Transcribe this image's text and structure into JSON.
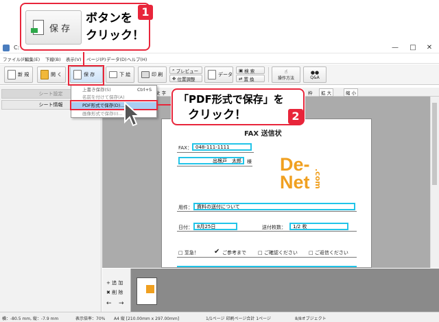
{
  "window": {
    "title": "C:\\Us...                                                    )ゼ２",
    "min": "—",
    "max": "□",
    "close": "✕"
  },
  "menu": [
    "ファイル(F)",
    "編集(E)",
    "下線(B)",
    "表示(V)",
    "ページ(P)",
    "データ(D)",
    "ヘルプ(H)"
  ],
  "toolbar": {
    "new_label": "新 規",
    "open_label": "開 く",
    "save_label": "保 存",
    "print_down_label": "下 絵",
    "print_label": "印 刷",
    "preview_label": "プレビュー",
    "position_label": "位置調整",
    "data_label": "データ",
    "search_label": "検 索",
    "replace_label": "置 換",
    "howto_label": "操作方法",
    "qa_label": "Q&A"
  },
  "dropdown": {
    "items": [
      "上書き保存(S)",
      "名前を付けて保存(A)",
      "PDF形式で保存(D)...",
      "画像形式で保存(I)..."
    ],
    "shortcut": "Ctrl+S"
  },
  "left_panel": {
    "tab_sheet_settings": "シート設定",
    "tab_sheet_info": "シート情報"
  },
  "view_toolbar": {
    "text_label": "文 字",
    "zoom_in": "拡 大",
    "zoom_out": "縮 小",
    "ellipsis": "...",
    "frame_label": "枠"
  },
  "document": {
    "title": "FAX 送信状",
    "fax_label": "FAX：",
    "fax_value": "048-111-1111",
    "name_value": "出根戸　太郎",
    "sama": "様",
    "logo_line1": "De-",
    "logo_line2": "Net",
    "logo_com": ".com",
    "subject_label": "用件：",
    "subject_value": "資料の送付について",
    "date_label": "日付：",
    "date_value": "8月25日",
    "pages_label": "送付枚数：",
    "pages_value": "1/2 枚",
    "check1": "□ 至急！",
    "check2": "ご参考まで",
    "check3": "□ ご確認ください",
    "check4": "□ ご返信ください"
  },
  "thumb_sidebar": {
    "add_label": "追 加",
    "delete_label": "削 除",
    "prev": "←",
    "next": "→"
  },
  "status": {
    "coords": "横：-80.5 mm, 縦：-7.9 mm",
    "zoom": "表示倍率：70%",
    "paper": "A4 縦 [210.00mm x 297.00mm]",
    "pages": "1/1ページ 印刷ページ合計 1ページ",
    "objects": "8/8オブジェクト"
  },
  "callout1": {
    "number": "1",
    "line1": "ボタンを",
    "line2": "クリック！",
    "button_label": "保 存"
  },
  "callout2": {
    "number": "2",
    "line1": "「PDF形式で保存」を",
    "line2": "クリック！"
  },
  "colors": {
    "accent_red": "#e8253a",
    "field_cyan": "#21c4e8",
    "logo_orange": "#f0a020"
  }
}
